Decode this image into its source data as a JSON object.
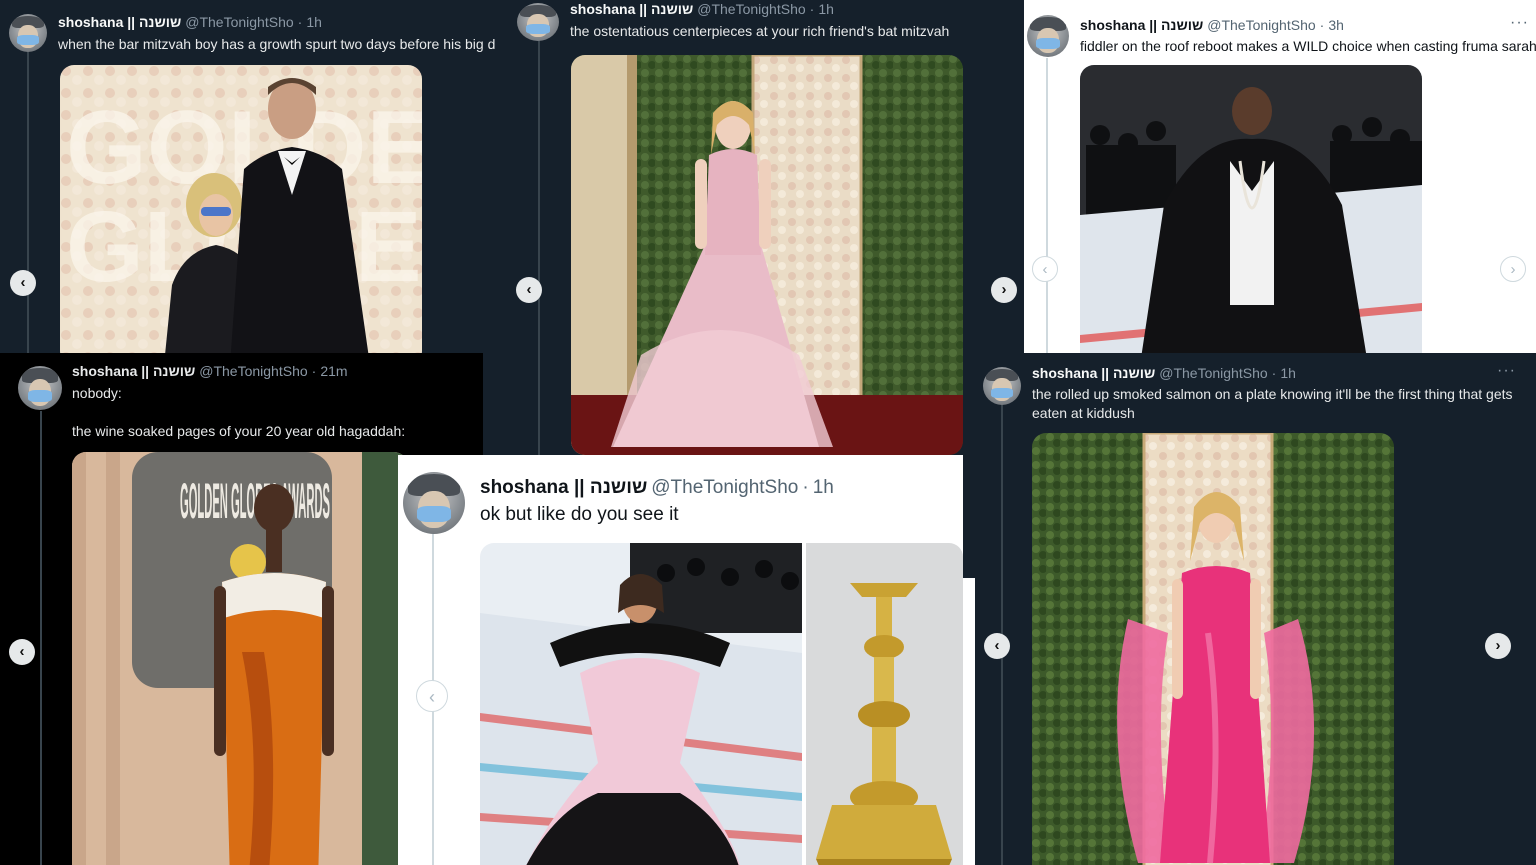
{
  "tweets": [
    {
      "name": "shoshana || שושנה",
      "handle": "@TheTonightSho",
      "time": "1h",
      "text": "when the bar mitzvah boy has a growth spurt two days before his big d"
    },
    {
      "name": "shoshana || שושנה",
      "handle": "@TheTonightSho",
      "time": "1h",
      "text": "the ostentatious centerpieces at your rich friend's bat mitzvah"
    },
    {
      "name": "shoshana || שושנה",
      "handle": "@TheTonightSho",
      "time": "3h",
      "text": "fiddler on the roof reboot makes a WILD choice when casting fruma sarah"
    },
    {
      "name": "shoshana || שושנה",
      "handle": "@TheTonightSho",
      "time": "21m",
      "text_line1": "nobody:",
      "text_line2": "the wine soaked pages of your 20 year old hagaddah:"
    },
    {
      "name": "shoshana || שושנה",
      "handle": "@TheTonightSho",
      "time": "1h",
      "text": "ok but like do you see it"
    },
    {
      "name": "shoshana || שושנה",
      "handle": "@TheTonightSho",
      "time": "1h",
      "text": "the rolled up smoked salmon on a plate knowing it'll be the first thing that gets eaten at kiddush"
    }
  ],
  "separator": "·",
  "more_icon": "···",
  "nav_prev": "‹",
  "nav_next": "›",
  "photo_text": {
    "globes_sign_1": "GOLDEN",
    "globes_sign_2": "GLOBES",
    "globes_sign_3": "GOLDEN GLOBES AWARDS"
  },
  "colors": {
    "dim_bg": "#15202b",
    "black_bg": "#000000",
    "light_bg": "#ffffff",
    "handle_gray": "#8b98a5"
  },
  "icons": {
    "avatar": "avatar-icon",
    "prev": "chevron-left-icon",
    "next": "chevron-right-icon",
    "more": "more-icon"
  }
}
